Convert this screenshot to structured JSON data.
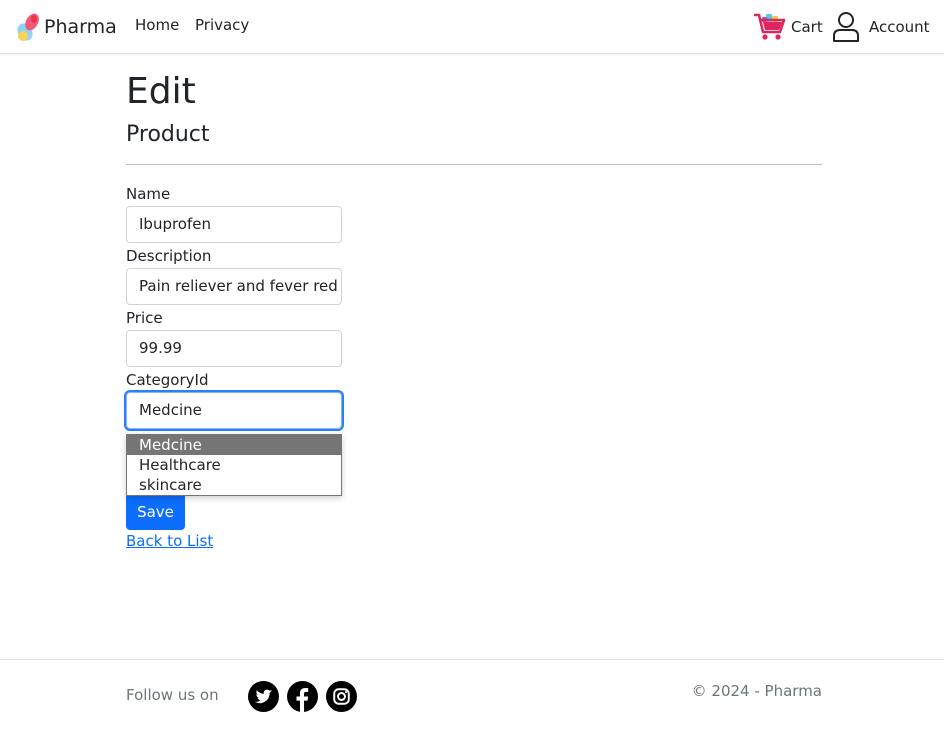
{
  "navbar": {
    "brand": "Pharma",
    "links": [
      "Home",
      "Privacy"
    ],
    "cart_label": "Cart",
    "account_label": "Account"
  },
  "page": {
    "title": "Edit",
    "subtitle": "Product"
  },
  "form": {
    "name_label": "Name",
    "name_value": "Ibuprofen",
    "description_label": "Description",
    "description_value": "Pain reliever and fever red",
    "price_label": "Price",
    "price_value": "99.99",
    "category_label": "CategoryId",
    "category_value": "Medcine",
    "category_options": [
      "Medcine",
      "Healthcare",
      "skincare"
    ],
    "save_label": "Save",
    "back_label": "Back to List"
  },
  "footer": {
    "follow_text": "Follow us on",
    "social": [
      "twitter-icon",
      "facebook-icon",
      "instagram-icon"
    ],
    "copyright": "© 2024 - Pharma"
  },
  "colors": {
    "primary": "#0d6efd",
    "cart_icon": "#e0245e",
    "selected_option": "#757575"
  }
}
